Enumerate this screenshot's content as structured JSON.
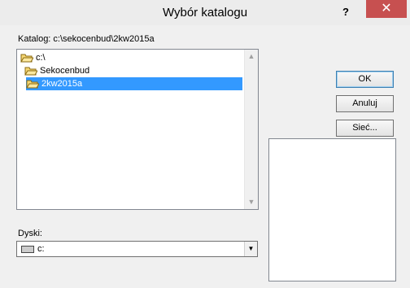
{
  "window": {
    "title": "Wybór katalogu",
    "help_label": "?",
    "close_label": "✕"
  },
  "catalog": {
    "label": "Katalog: c:\\sekocenbud\\2kw2015a"
  },
  "directory_tree": {
    "items": [
      {
        "label": "c:\\",
        "selected": false
      },
      {
        "label": "Sekocenbud",
        "selected": false
      },
      {
        "label": "2kw2015a",
        "selected": true
      }
    ]
  },
  "drives": {
    "label": "Dyski:",
    "selected": "c:"
  },
  "buttons": {
    "ok": "OK",
    "cancel": "Anuluj",
    "network": "Sieć..."
  },
  "colors": {
    "selection": "#3399ff",
    "close_button": "#c75050",
    "folder_fill": "#f5d774"
  }
}
